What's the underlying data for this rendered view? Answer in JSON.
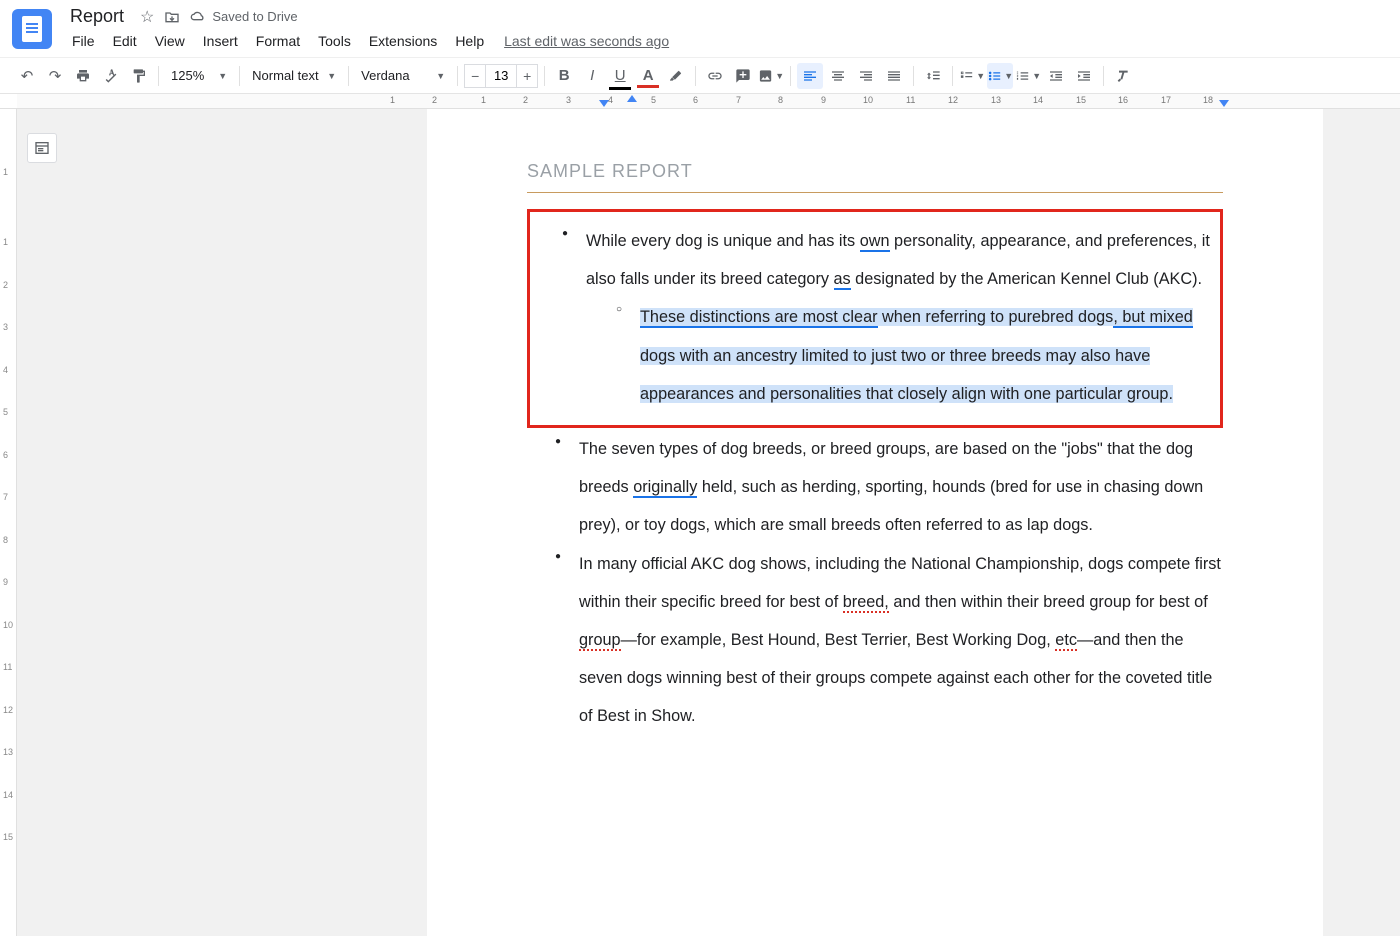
{
  "header": {
    "doc_title": "Report",
    "saved_text": "Saved to Drive",
    "menus": [
      "File",
      "Edit",
      "View",
      "Insert",
      "Format",
      "Tools",
      "Extensions",
      "Help"
    ],
    "last_edit": "Last edit was seconds ago"
  },
  "toolbar": {
    "zoom": "125%",
    "style": "Normal text",
    "font": "Verdana",
    "font_size": "13"
  },
  "ruler": {
    "numbers": [
      "2",
      "1",
      "1",
      "2",
      "3",
      "4",
      "5",
      "6",
      "7",
      "8",
      "9",
      "10",
      "11",
      "12",
      "13",
      "14",
      "15",
      "16",
      "17",
      "18"
    ]
  },
  "vruler": {
    "numbers": [
      "1",
      "1",
      "2",
      "3",
      "4",
      "5",
      "6",
      "7",
      "8",
      "9",
      "10",
      "11",
      "12",
      "13",
      "14",
      "15"
    ]
  },
  "doc": {
    "heading": "SAMPLE REPORT",
    "b1_a": "While every dog is unique and has its ",
    "b1_own": "own",
    "b1_b": " personality, appearance, and preferences, it also falls under its breed category ",
    "b1_as": "as",
    "b1_c": " designated by the American Kennel Club (AKC).",
    "s1_a": "These distinctions are most clear",
    "s1_b": " when referring to purebred dogs",
    "s1_c": ", but mixed",
    "s1_d": " dogs with an ancestry limited to just two or three breeds may also have appearances and personalities that closely align with one particular group.",
    "b2_a": "The seven types of dog breeds, or breed groups, are based on the \"jobs\" that the dog breeds ",
    "b2_orig": "originally",
    "b2_b": " held, such as herding, sporting, hounds (bred for use in chasing down prey), or toy dogs, which are small breeds often referred to as lap dogs.",
    "b3_a": "In many official AKC dog shows, including the National Championship, dogs compete first within their specific breed for best of ",
    "b3_breed": "breed,",
    "b3_b": " and then within their breed group for best of ",
    "b3_group": "group",
    "b3_c": "—for example, Best Hound, Best Terrier, Best Working Dog, ",
    "b3_etc": "etc",
    "b3_d": "—and then the seven dogs winning best of their groups compete against each other for the coveted title of Best in Show."
  }
}
